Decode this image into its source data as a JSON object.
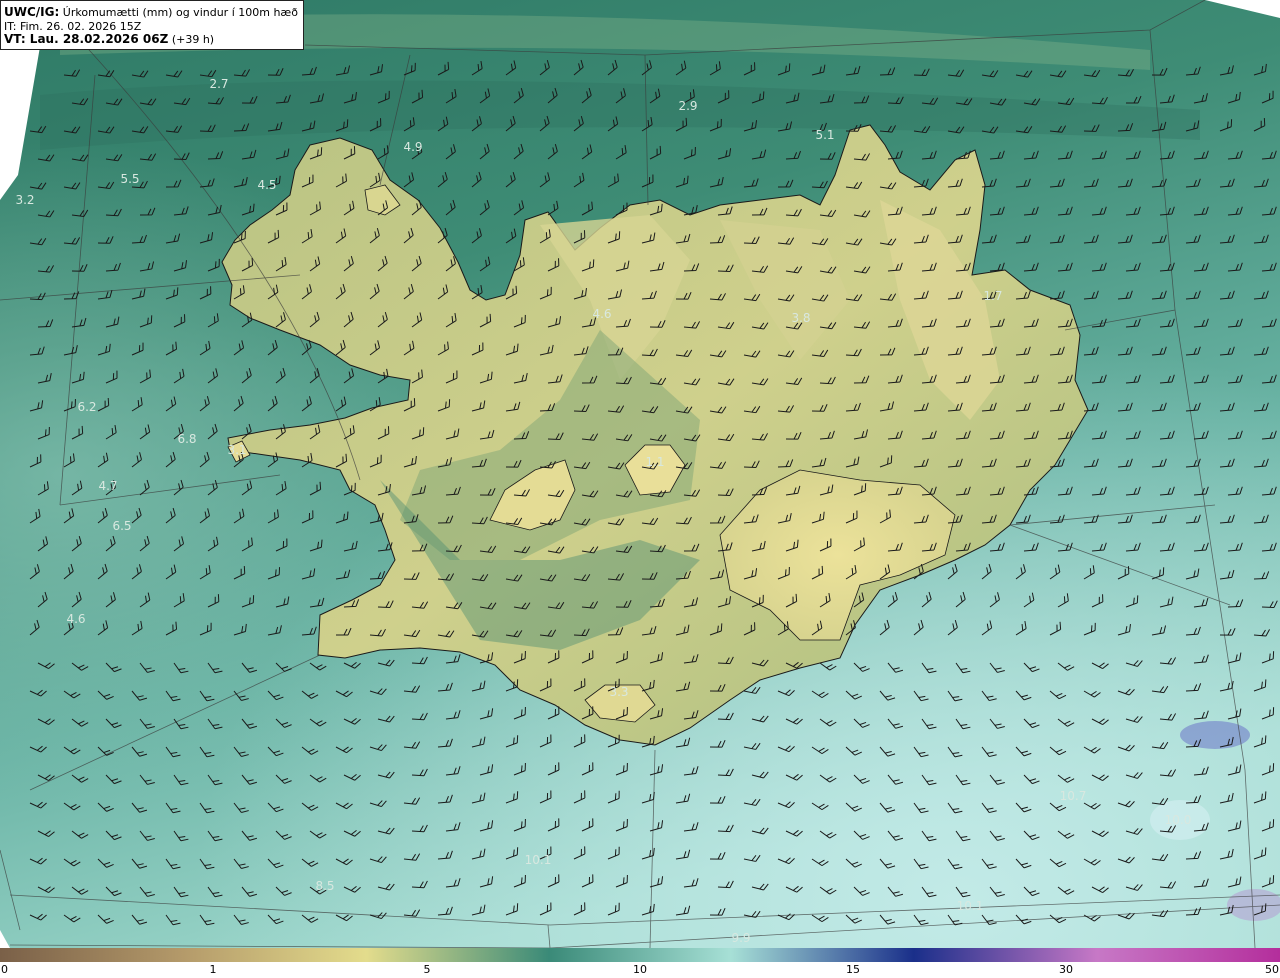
{
  "title": {
    "product": "UWC/IG:",
    "description": "Úrkomumætti (mm) og vindur í 100m hæð",
    "init_time": "IT: Fim. 26. 02. 2026 15Z",
    "valid_label": "VT: Lau. 28.02.2026 06Z",
    "valid_offset": "(+39 h)"
  },
  "map_values": [
    {
      "text": "2.7"
    },
    {
      "text": "2.9"
    },
    {
      "text": "4.9"
    },
    {
      "text": "5.1"
    },
    {
      "text": "5.5"
    },
    {
      "text": "4.5"
    },
    {
      "text": "3.2"
    },
    {
      "text": "4.6"
    },
    {
      "text": "3.8"
    },
    {
      "text": "1.7"
    },
    {
      "text": "6.2"
    },
    {
      "text": "6.8"
    },
    {
      "text": "3.1"
    },
    {
      "text": "4.7"
    },
    {
      "text": "1.1"
    },
    {
      "text": "6.5"
    },
    {
      "text": "4.6"
    },
    {
      "text": "3.3"
    },
    {
      "text": "10.7"
    },
    {
      "text": "10.0"
    },
    {
      "text": "10.1"
    },
    {
      "text": "10.1"
    },
    {
      "text": "9.9"
    },
    {
      "text": "8.5"
    }
  ],
  "colorbar": {
    "ticks": [
      "0",
      "1",
      "5",
      "10",
      "15",
      "30",
      "50"
    ],
    "colors": [
      "#7a6048",
      "#b49a6a",
      "#e3dc8c",
      "#3a8a78",
      "#a7e0d6",
      "#1a2f8a",
      "#c778c6",
      "#b42e9c"
    ]
  }
}
